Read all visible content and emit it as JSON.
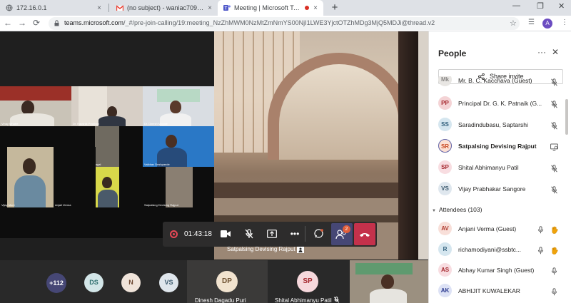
{
  "browser": {
    "tabs": [
      {
        "label": "172.16.0.1",
        "icon": "globe-icon"
      },
      {
        "label": "(no subject) - waniac7095@gmail.com",
        "icon": "gmail-icon"
      },
      {
        "label": "Meeting | Microsoft Teams",
        "icon": "teams-icon",
        "active": true
      }
    ],
    "url_host": "teams.microsoft.com",
    "url_path": "/_#/pre-join-calling/19:meeting_NzZhMWM0NzMtZmNmYS00NjI1LWE3YjctOTZhMDg3MjQ5MDJi@thread.v2",
    "account_initial": "A"
  },
  "meeting": {
    "timer": "01:43:18",
    "people_badge": "2",
    "speaker_name": "Satpalsing Devising Rajput",
    "gallery": [
      {
        "name": "Vinay Mhatre"
      },
      {
        "name": "Dr. Kaushik Pradhan"
      },
      {
        "name": "Dr. Dinesh Mugale"
      },
      {
        "name": "Satpalsing Devising Rajput"
      },
      {
        "name": "Vaibhav Deshpande"
      },
      {
        "name": "Dipak Devishad Bagal"
      },
      {
        "name": "Vijay More"
      },
      {
        "name": "Anjali Verma"
      },
      {
        "name": "Satpalsing Devising Rajput"
      }
    ],
    "bottom": {
      "overflow_count": "+112",
      "avatars": [
        "DS",
        "N",
        "VS"
      ],
      "featured": [
        {
          "initials": "DP",
          "name": "Dinesh Dagadu Puri"
        },
        {
          "initials": "SP",
          "name": "Shital Abhimanyu Patil"
        }
      ]
    }
  },
  "panel": {
    "title": "People",
    "share_label": "Share invite",
    "attendees_label": "Attendees (103)",
    "presenters": [
      {
        "initials": "Mk",
        "name": "Mr. B. C. Kacchava (Guest)",
        "color": "#8a8886",
        "bg": "#e8e6e3"
      },
      {
        "initials": "PP",
        "name": "Principal Dr. G. K. Patnaik (G...",
        "color": "#a4262c",
        "bg": "#f4d3d5"
      },
      {
        "initials": "SS",
        "name": "Saradindubasu, Saptarshi",
        "color": "#2e5d7a",
        "bg": "#d5e6ef"
      },
      {
        "initials": "SR",
        "name": "Satpalsing Devising Rajput",
        "color": "#c94a25",
        "bg": "#fbe0d5",
        "bold": true
      },
      {
        "initials": "SP",
        "name": "Shital Abhimanyu Patil",
        "color": "#a4262c",
        "bg": "#f8dde1"
      },
      {
        "initials": "VS",
        "name": "Vijay Prabhakar Sangore",
        "color": "#3c5a6e",
        "bg": "#dfe7ee"
      }
    ],
    "attendees": [
      {
        "initials": "AV",
        "name": "Anjani Verma (Guest)",
        "color": "#b03a2e",
        "bg": "#f8dfd9",
        "hand": true
      },
      {
        "initials": "R",
        "name": "richamodiyani@ssbtc...",
        "color": "#2e5d7a",
        "bg": "#d5e6ef",
        "hand": true
      },
      {
        "initials": "AS",
        "name": "Abhay Kumar Singh (Guest)",
        "color": "#a4262c",
        "bg": "#f8dde1",
        "hand": false
      },
      {
        "initials": "AK",
        "name": "ABHIJIT KUWALEKAR",
        "color": "#2b3a8f",
        "bg": "#dde2f5",
        "hand": false
      }
    ]
  }
}
